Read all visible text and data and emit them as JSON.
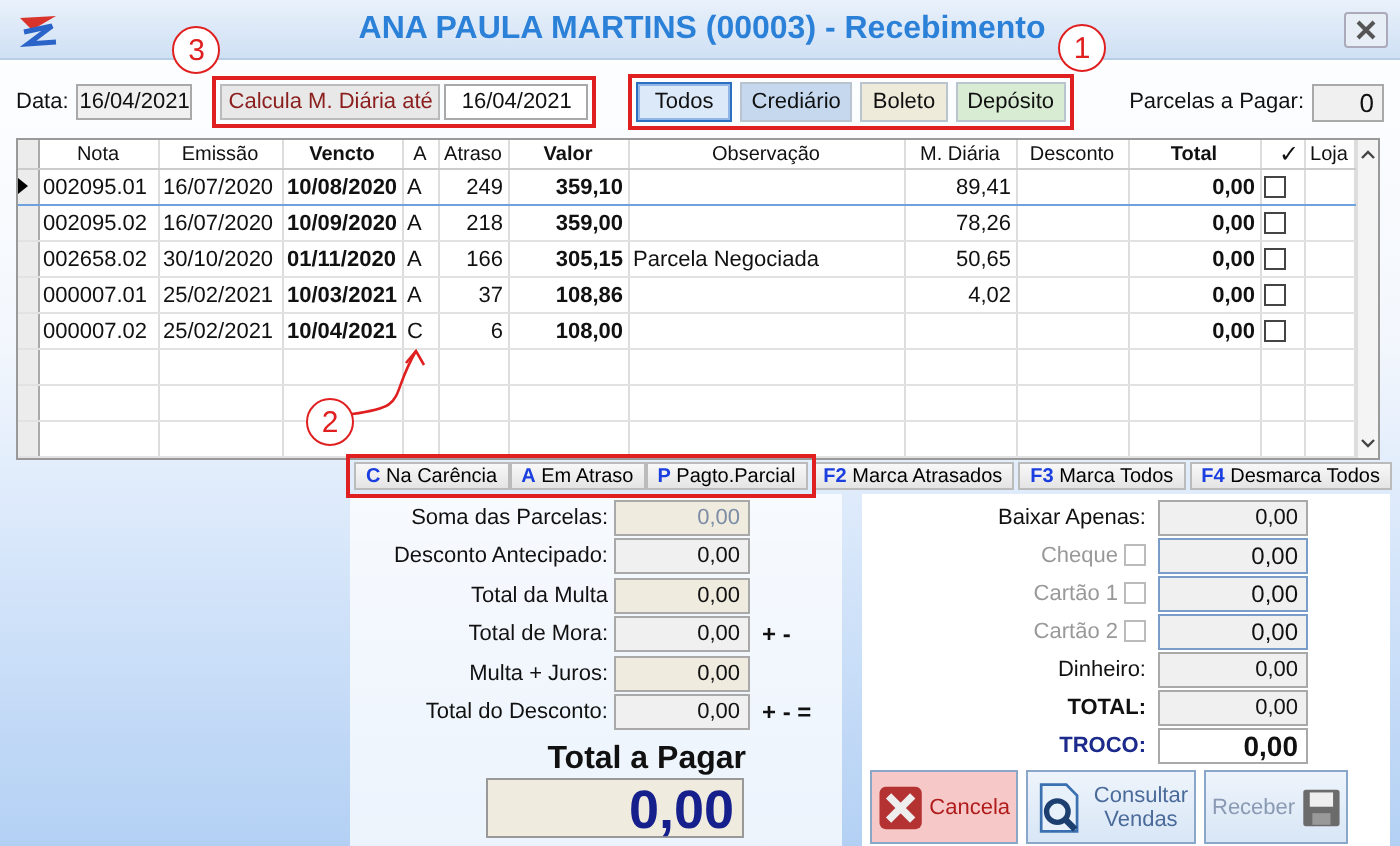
{
  "window": {
    "title": "ANA PAULA MARTINS (00003) - Recebimento"
  },
  "toolbar": {
    "date_label": "Data:",
    "date": "16/04/2021",
    "calc_button": "Calcula M. Diária até",
    "calc_date": "16/04/2021",
    "filters": [
      {
        "label": "Todos",
        "selected": true,
        "color": "#dbe9f8"
      },
      {
        "label": "Crediário",
        "selected": false,
        "color": "#c5d8ee"
      },
      {
        "label": "Boleto",
        "selected": false,
        "color": "#efebdb"
      },
      {
        "label": "Depósito",
        "selected": false,
        "color": "#d8ecd3"
      }
    ],
    "parcelas_label": "Parcelas a Pagar:",
    "parcelas": "0"
  },
  "table": {
    "columns": [
      "Nota",
      "Emissão",
      "Vencto",
      "A",
      "Atraso",
      "Valor",
      "Observação",
      "M. Diária",
      "Desconto",
      "Total",
      "✓",
      "Loja"
    ],
    "rows": [
      {
        "nota": "002095.01",
        "emissao": "16/07/2020",
        "vencto": "10/08/2020",
        "a": "A",
        "atraso": "249",
        "valor": "359,10",
        "m_diaria": "89,41",
        "total": "0,00",
        "checked": false,
        "selected": true
      },
      {
        "nota": "002095.02",
        "emissao": "16/07/2020",
        "vencto": "10/09/2020",
        "a": "A",
        "atraso": "218",
        "valor": "359,00",
        "m_diaria": "78,26",
        "total": "0,00",
        "checked": false,
        "selected": false
      },
      {
        "nota": "002658.02",
        "emissao": "30/10/2020",
        "vencto": "01/11/2020",
        "a": "A",
        "atraso": "166",
        "valor": "305,15",
        "observacao": "Parcela Negociada",
        "m_diaria": "50,65",
        "total": "0,00",
        "checked": false,
        "selected": false
      },
      {
        "nota": "000007.01",
        "emissao": "25/02/2021",
        "vencto": "10/03/2021",
        "a": "A",
        "atraso": "37",
        "valor": "108,86",
        "m_diaria": "4,02",
        "total": "0,00",
        "checked": false,
        "selected": false
      },
      {
        "nota": "000007.02",
        "emissao": "25/02/2021",
        "vencto": "10/04/2021",
        "a": "C",
        "atraso": "6",
        "valor": "108,00",
        "total": "0,00",
        "checked": false,
        "selected": false
      }
    ]
  },
  "legend": [
    {
      "key": "C",
      "label": "Na Carência"
    },
    {
      "key": "A",
      "label": "Em Atraso"
    },
    {
      "key": "P",
      "label": "Pagto.Parcial"
    }
  ],
  "actions": [
    {
      "key": "F2",
      "label": "Marca Atrasados"
    },
    {
      "key": "F3",
      "label": "Marca Todos"
    },
    {
      "key": "F4",
      "label": "Desmarca Todos"
    }
  ],
  "summary": [
    {
      "label": "Soma das Parcelas:",
      "value": "0,00",
      "kind": "sum"
    },
    {
      "label": "Desconto Antecipado:",
      "value": "0,00",
      "kind": "input"
    },
    {
      "label": "Total da Multa",
      "value": "0,00",
      "kind": "readonly"
    },
    {
      "label": "Total de Mora:",
      "value": "0,00",
      "kind": "input",
      "suffix": "+ -"
    },
    {
      "label": "Multa + Juros:",
      "value": "0,00",
      "kind": "readonly"
    },
    {
      "label": "Total do Desconto:",
      "value": "0,00",
      "kind": "input",
      "suffix": "+ - ="
    }
  ],
  "total_due": {
    "label": "Total a Pagar",
    "value": "0,00"
  },
  "payment": [
    {
      "label": "Baixar Apenas:",
      "value": "0,00",
      "kind": "input"
    },
    {
      "label": "Cheque",
      "value": "0,00",
      "kind": "option",
      "checked": false,
      "disabled": true
    },
    {
      "label": "Cartão 1",
      "value": "0,00",
      "kind": "option",
      "checked": false,
      "disabled": true
    },
    {
      "label": "Cartão 2",
      "value": "0,00",
      "kind": "option",
      "checked": false,
      "disabled": true
    },
    {
      "label": "Dinheiro:",
      "value": "0,00",
      "kind": "input"
    },
    {
      "label": "TOTAL:",
      "value": "0,00",
      "kind": "total"
    },
    {
      "label": "TROCO:",
      "value": "0,00",
      "kind": "change"
    }
  ],
  "buttons": [
    {
      "label": "Cancela",
      "kind": "cancel",
      "disabled": false
    },
    {
      "label": "Consultar Vendas",
      "kind": "search",
      "disabled": false
    },
    {
      "label": "Receber",
      "kind": "save",
      "disabled": true
    }
  ],
  "callouts": {
    "calc": "3",
    "filters": "1",
    "legend": "2"
  }
}
